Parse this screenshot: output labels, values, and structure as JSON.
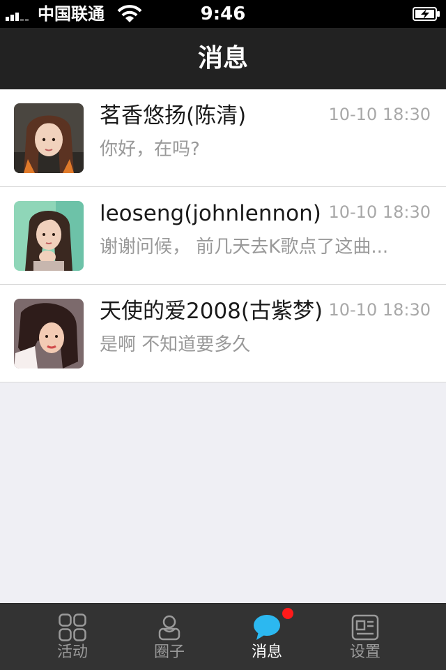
{
  "status_bar": {
    "carrier": "中国联通",
    "time": "9:46"
  },
  "nav": {
    "title": "消息"
  },
  "messages": [
    {
      "name": "茗香悠扬(陈清)",
      "time": "10-10 18:30",
      "preview": "你好，在吗?"
    },
    {
      "name": "leoseng(johnlennon)",
      "time": "10-10 18:30",
      "preview": "谢谢问候， 前几天去K歌点了这曲..."
    },
    {
      "name": "天使的爱2008(古紫梦)",
      "time": "10-10 18:30",
      "preview": "是啊 不知道要多久"
    }
  ],
  "tabs": [
    {
      "label": "活动",
      "icon": "grid-icon"
    },
    {
      "label": "圈子",
      "icon": "person-icon"
    },
    {
      "label": "消息",
      "icon": "chat-bubble-icon",
      "active": true,
      "badge": true
    },
    {
      "label": "设置",
      "icon": "settings-card-icon"
    }
  ],
  "colors": {
    "nav_bg": "#222222",
    "tab_bg": "#333333",
    "active_icon": "#2cb8f0",
    "badge": "#ff1a1a",
    "list_bg": "#ffffff",
    "page_bg": "#efeff4"
  }
}
